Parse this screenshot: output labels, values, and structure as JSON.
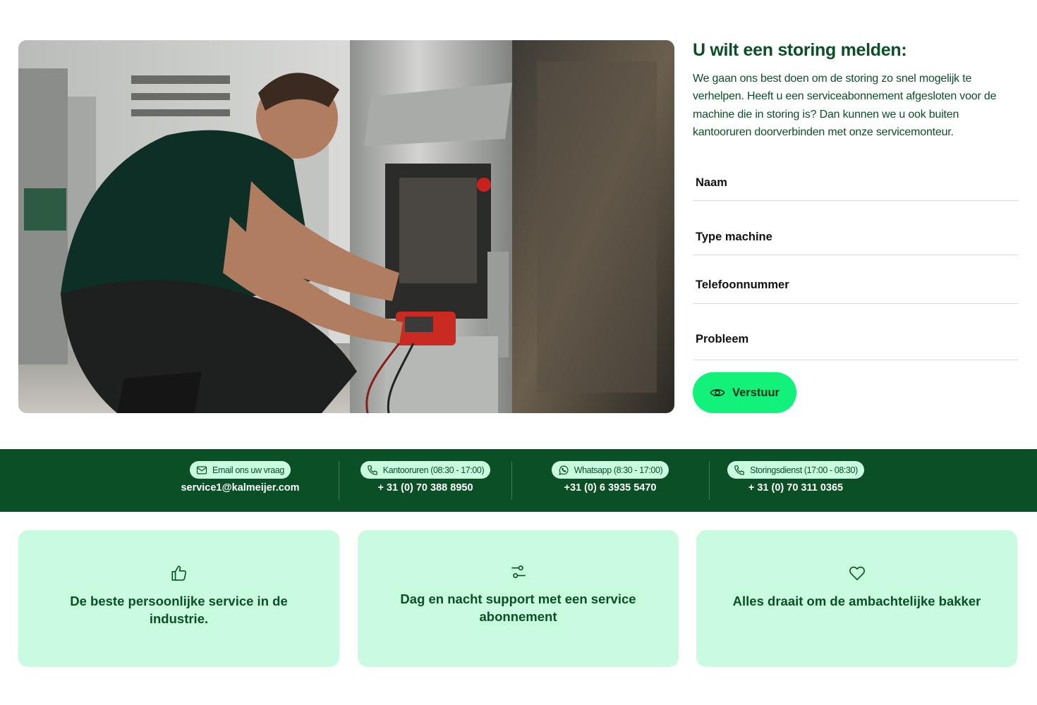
{
  "form": {
    "title": "U wilt een storing melden:",
    "intro": "We gaan ons best doen om de storing zo snel mogelijk te verhelpen. Heeft u een serviceabonnement afgesloten voor de machine die in storing is? Dan kunnen we u ook buiten kantooruren doorverbinden met onze servicemonteur.",
    "fields": [
      {
        "placeholder": "Naam",
        "value": ""
      },
      {
        "placeholder": "Type machine",
        "value": ""
      },
      {
        "placeholder": "Telefoonnummer",
        "value": ""
      },
      {
        "placeholder": "Probleem",
        "value": ""
      }
    ],
    "submit_label": "Verstuur",
    "submit_icon": "eye-icon"
  },
  "contacts": [
    {
      "label": "Email ons uw vraag",
      "value": "service1@kalmeijer.com",
      "icon": "mail-icon"
    },
    {
      "label": "Kantooruren (08:30 - 17:00)",
      "value": "+ 31 (0) 70 388 8950",
      "icon": "phone-icon"
    },
    {
      "label": "Whatsapp (8:30 - 17:00)",
      "value": "+31 (0) 6 3935 5470",
      "icon": "whatsapp-icon"
    },
    {
      "label": "Storingsdienst (17:00 - 08:30)",
      "value": "+ 31 (0) 70 311 0365",
      "icon": "phone-icon"
    }
  ],
  "features": [
    {
      "text": "De beste persoonlijke service in de industrie.",
      "icon": "thumbs-up-icon"
    },
    {
      "text": "Dag en nacht support met een service abonnement",
      "icon": "sliders-icon"
    },
    {
      "text": "Alles draait om de ambachtelijke bakker",
      "icon": "heart-icon"
    }
  ],
  "colors": {
    "brand_green": "#0b4f26",
    "accent_green": "#12f27a",
    "mint": "#c8fbe0"
  }
}
